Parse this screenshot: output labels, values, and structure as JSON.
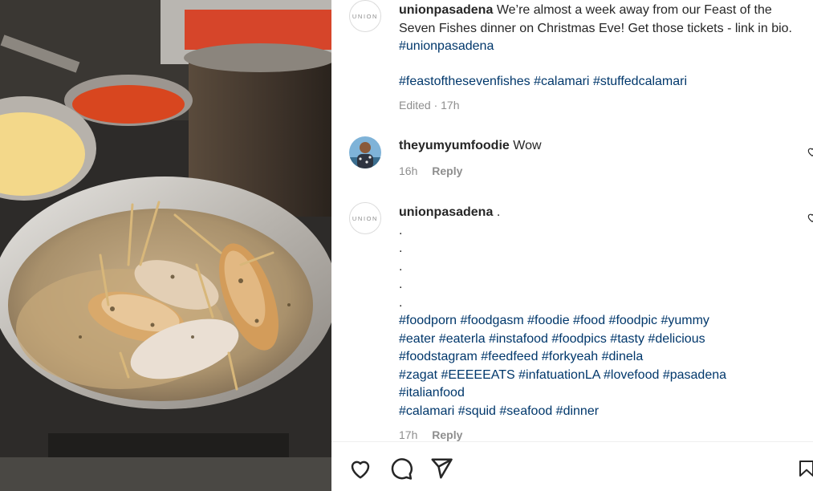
{
  "caption": {
    "avatar_text": "UNION",
    "username": "unionpasadena",
    "text": "We’re almost a week away from our Feast of the Seven Fishes dinner on Christmas Eve! Get those tickets - link in bio.",
    "inline_tag": "#unionpasadena",
    "hashtags": [
      "#feastofthesevenfishes",
      "#calamari",
      "#stuffedcalamari"
    ],
    "meta": "Edited · 17h"
  },
  "comment1": {
    "username": "theyumyumfoodie",
    "text": "Wow",
    "time": "16h",
    "reply": "Reply",
    "like_icon": "heart-outline-icon"
  },
  "comment2": {
    "avatar_text": "UNION",
    "username": "unionpasadena",
    "first_line": ".",
    "dots": [
      ".",
      ".",
      ".",
      ".",
      "."
    ],
    "hashtag_lines": [
      "#foodporn #foodgasm #foodie #food #foodpic #yummy",
      "#eater #eaterla #instafood #foodpics #tasty #delicious",
      "#foodstagram #feedfeed #forkyeah #dinela",
      "#zagat #EEEEEATS #infatuationLA #lovefood #pasadena",
      "#italianfood",
      "#calamari #squid #seafood #dinner"
    ],
    "time": "17h",
    "reply": "Reply",
    "like_icon": "heart-outline-icon"
  },
  "actions": {
    "icons": [
      "heart-icon",
      "comment-icon",
      "share-icon",
      "bookmark-icon"
    ]
  },
  "colors": {
    "hashtag": "#00376b",
    "muted": "#8e8e8e",
    "text": "#262626"
  }
}
